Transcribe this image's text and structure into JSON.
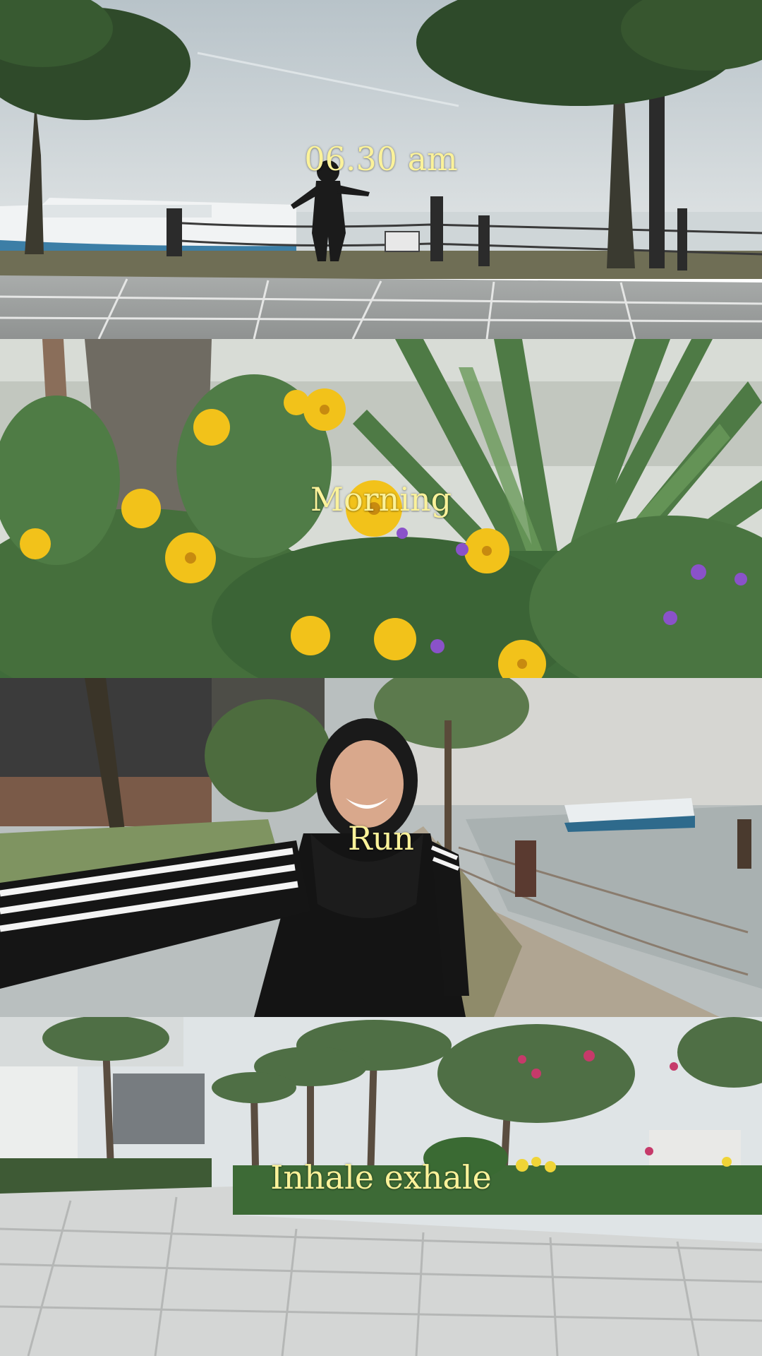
{
  "panels": [
    {
      "id": "waterfront-pose",
      "caption": "06.30 am"
    },
    {
      "id": "yellow-flowers",
      "caption": "Morning"
    },
    {
      "id": "run-selfie",
      "caption": "Run"
    },
    {
      "id": "palm-garden",
      "caption": "Inhale exhale"
    }
  ],
  "colors": {
    "caption": "#fbf29a",
    "sky": "#c9d2d6",
    "foliage": "#3f6b3a",
    "flower": "#f2c21a",
    "paving": "#c7c9c8"
  }
}
